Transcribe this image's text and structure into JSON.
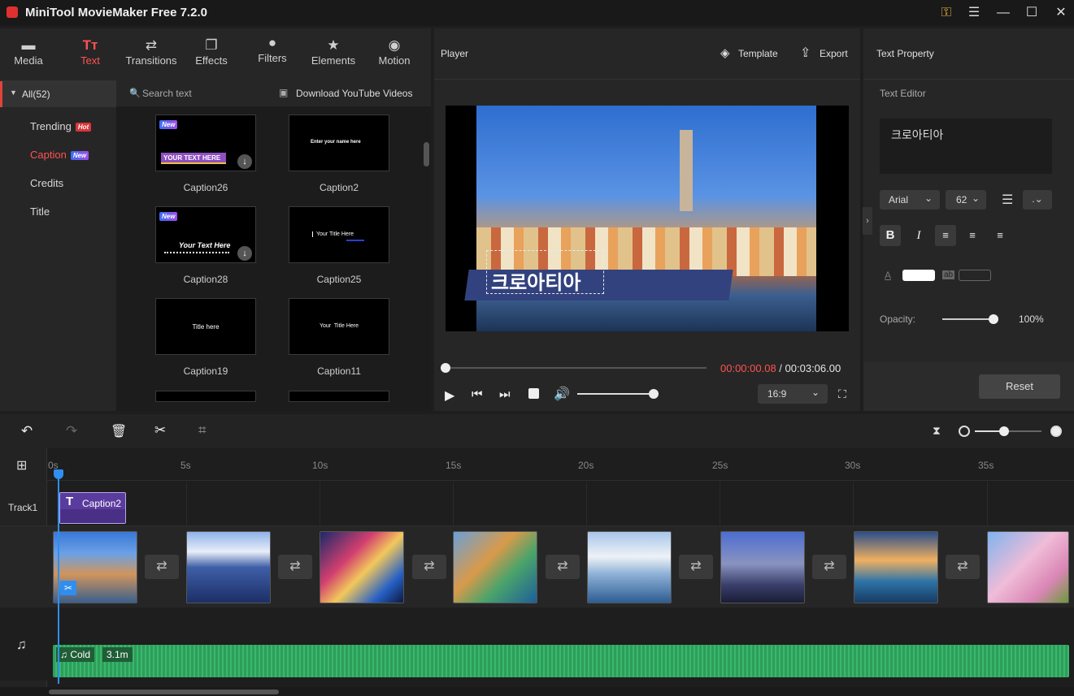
{
  "app": {
    "title": "MiniTool MovieMaker Free 7.2.0"
  },
  "toolbar": {
    "tabs": [
      {
        "label": "Media",
        "icon": "folder-icon"
      },
      {
        "label": "Text",
        "icon": "text-icon"
      },
      {
        "label": "Transitions",
        "icon": "transitions-icon"
      },
      {
        "label": "Effects",
        "icon": "effects-icon"
      },
      {
        "label": "Filters",
        "icon": "filters-icon"
      },
      {
        "label": "Elements",
        "icon": "elements-icon"
      },
      {
        "label": "Motion",
        "icon": "motion-icon"
      }
    ],
    "active_tab": "Text"
  },
  "sidebar": {
    "all_label": "All(52)",
    "items": [
      {
        "label": "Trending",
        "badge": "Hot"
      },
      {
        "label": "Caption",
        "badge": "New"
      },
      {
        "label": "Credits"
      },
      {
        "label": "Title"
      }
    ]
  },
  "search": {
    "placeholder": "Search text",
    "download_label": "Download YouTube Videos"
  },
  "captions": [
    {
      "name": "Caption26",
      "preview": "YOUR TEXT HERE",
      "badge": "New"
    },
    {
      "name": "Caption2",
      "preview": "Enter your name here"
    },
    {
      "name": "Caption28",
      "preview": "Your Text Here",
      "badge": "New"
    },
    {
      "name": "Caption25",
      "preview": "Your Title Here"
    },
    {
      "name": "Caption19",
      "preview": "Title here"
    },
    {
      "name": "Caption11",
      "preview": "Your  Title Here"
    }
  ],
  "player": {
    "title": "Player",
    "template_label": "Template",
    "export_label": "Export",
    "overlay_text": "크로아티아",
    "current_time": "00:00:00.08",
    "time_sep": " / ",
    "total_time": "00:03:06.00",
    "aspect": "16:9"
  },
  "text_property": {
    "title": "Text Property",
    "editor_label": "Text Editor",
    "text": "크로아티아",
    "font": "Arial",
    "size": "62",
    "opacity_label": "Opacity:",
    "opacity": "100%",
    "reset_label": "Reset"
  },
  "timeline": {
    "ruler": [
      "0s",
      "5s",
      "10s",
      "15s",
      "20s",
      "25s",
      "30s",
      "35s"
    ],
    "track1_label": "Track1",
    "caption_clip": "Caption2",
    "audio_name": "Cold",
    "audio_duration": "3.1m"
  },
  "colors": {
    "accent": "#ff5252",
    "playhead": "#2f8ef0",
    "audio": "#2e9e5b",
    "caption_clip": "#5a3c9e"
  }
}
